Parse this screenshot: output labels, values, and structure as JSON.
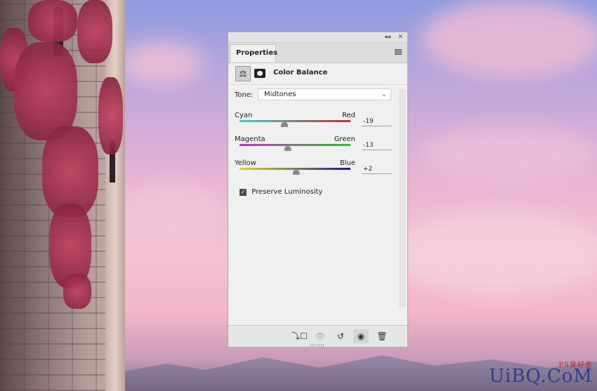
{
  "panel": {
    "tab_label": "Properties",
    "title": "Color Balance",
    "tone_label": "Tone:",
    "tone_value": "Midtones",
    "sliders": [
      {
        "left": "Cyan",
        "right": "Red",
        "value": "-19",
        "level": -19
      },
      {
        "left": "Magenta",
        "right": "Green",
        "value": "-13",
        "level": -13
      },
      {
        "left": "Yellow",
        "right": "Blue",
        "value": "+2",
        "level": 2
      }
    ],
    "preserve_luminosity_label": "Preserve Luminosity",
    "preserve_luminosity_checked": true,
    "footer_icons": [
      "clip-to-layer-icon",
      "view-previous-state-icon",
      "reset-icon",
      "visibility-eye-icon",
      "trash-icon"
    ]
  },
  "watermark": {
    "text": "UiBQ.CoM",
    "small": "PS爱好者"
  },
  "colors": {
    "panel_bg": "#f0f0f0",
    "thumb": "#8a8a8a"
  }
}
